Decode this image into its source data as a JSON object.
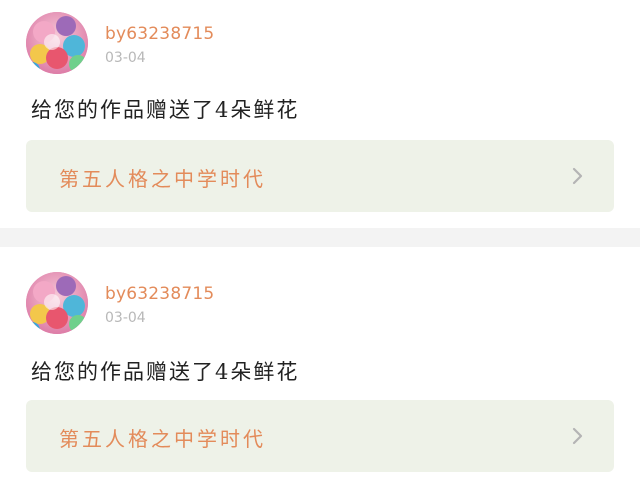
{
  "feed": {
    "items": [
      {
        "username": "by63238715",
        "date": "03-04",
        "message": "给您的作品赠送了4朵鲜花",
        "work_title": "第五人格之中学时代",
        "avatar_icon": "balloon-avatar-icon",
        "chevron_icon": "chevron-right-icon"
      },
      {
        "username": "by63238715",
        "date": "03-04",
        "message": "给您的作品赠送了4朵鲜花",
        "work_title": "第五人格之中学时代",
        "avatar_icon": "balloon-avatar-icon",
        "chevron_icon": "chevron-right-icon"
      }
    ]
  },
  "colors": {
    "accent": "#e38b5a",
    "card_link_bg": "#eef2e8",
    "separator": "#f3f3f3",
    "date_text": "#b8b8b8",
    "message_text": "#222222"
  }
}
